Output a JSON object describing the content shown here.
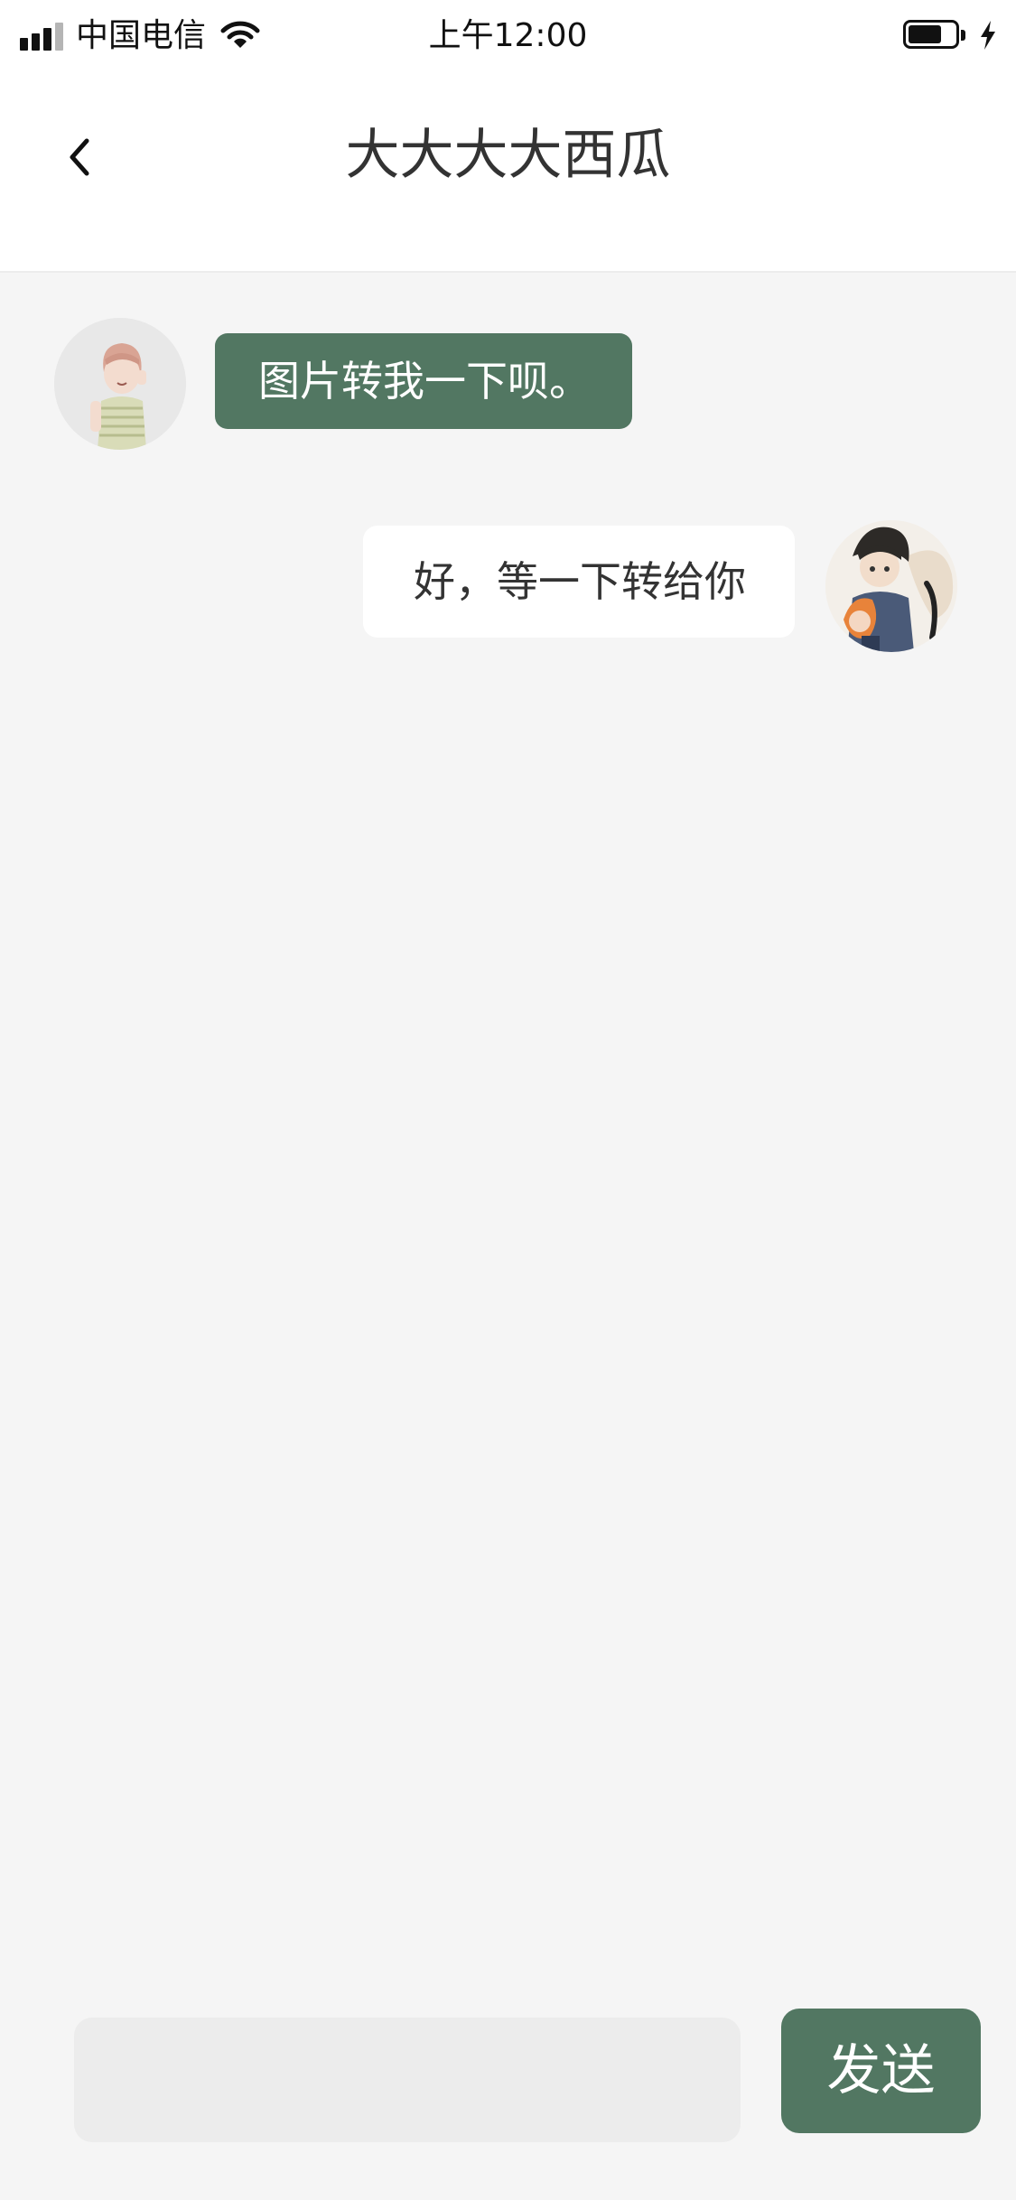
{
  "status_bar": {
    "carrier": "中国电信",
    "time": "上午12:00",
    "signal_bars_active": 3,
    "signal_bars_total": 4,
    "battery_level_fraction": 0.6,
    "charging": true
  },
  "nav": {
    "title": "大大大大西瓜",
    "back_icon": "chevron-left-icon"
  },
  "messages": [
    {
      "side": "left",
      "text": "图片转我一下呗。",
      "avatar": "contact-avatar"
    },
    {
      "side": "right",
      "text": "好，等一下转给你",
      "avatar": "user-avatar"
    }
  ],
  "composer": {
    "input_value": "",
    "placeholder": "",
    "send_label": "发送"
  },
  "colors": {
    "accent": "#527762",
    "background": "#f5f5f5",
    "bubble_incoming": "#ffffff",
    "input_background": "#ececec",
    "title_text": "#333333"
  }
}
